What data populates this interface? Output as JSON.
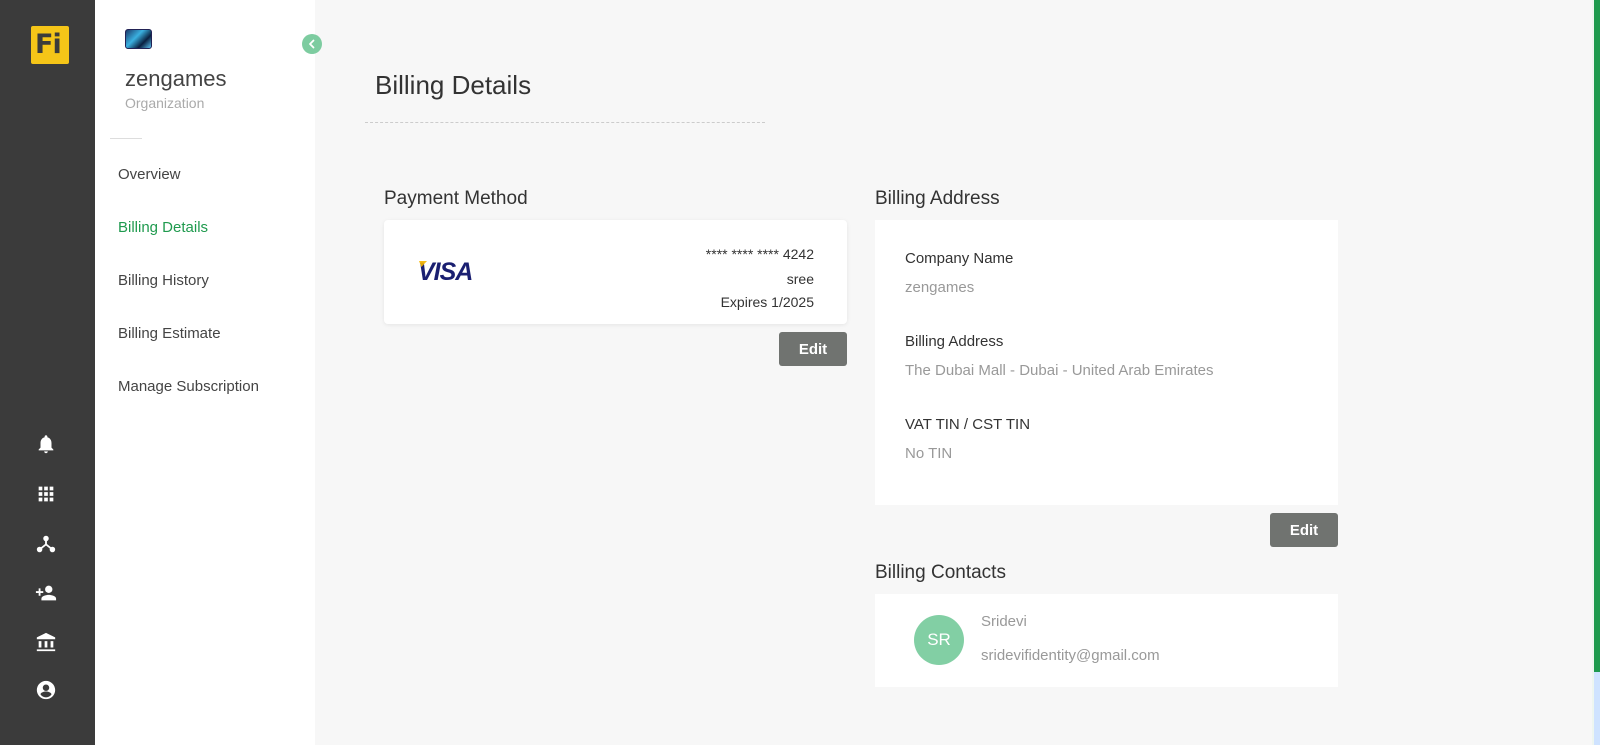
{
  "rail": {
    "logo_text": "Fi",
    "icons": [
      "bell-icon",
      "apps-grid-icon",
      "hierarchy-icon",
      "add-user-icon",
      "bank-icon",
      "account-circle-icon"
    ]
  },
  "org": {
    "name": "zengames",
    "type": "Organization"
  },
  "nav": {
    "items": [
      "Overview",
      "Billing Details",
      "Billing History",
      "Billing Estimate",
      "Manage Subscription"
    ],
    "active": "Billing Details"
  },
  "page": {
    "title": "Billing Details"
  },
  "payment": {
    "section_title": "Payment Method",
    "brand": "VISA",
    "number": "**** **** **** 4242",
    "holder": "sree",
    "expiry": "Expires 1/2025",
    "edit_label": "Edit"
  },
  "address": {
    "section_title": "Billing Address",
    "company_label": "Company Name",
    "company_value": "zengames",
    "address_label": "Billing Address",
    "address_value": "The Dubai Mall - Dubai - United Arab Emirates",
    "tin_label": "VAT TIN / CST TIN",
    "tin_value": "No TIN",
    "edit_label": "Edit"
  },
  "contacts": {
    "section_title": "Billing Contacts",
    "initials": "SR",
    "name": "Sridevi",
    "email": "sridevifidentity@gmail.com"
  },
  "colors": {
    "rail_bg": "#3b3b3b",
    "accent_green": "#1f9a4e",
    "logo_yellow": "#f5c518",
    "button_gray": "#707370"
  }
}
